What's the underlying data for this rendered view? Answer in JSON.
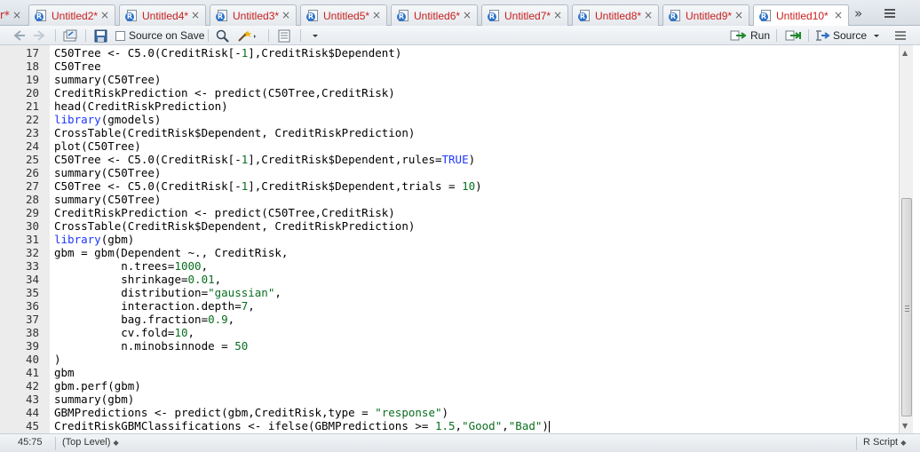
{
  "tabs": {
    "partial_label": "r*",
    "close_symbol": "×",
    "items": [
      {
        "label": "Untitled2*",
        "active": false
      },
      {
        "label": "Untitled4*",
        "active": false
      },
      {
        "label": "Untitled3*",
        "active": false
      },
      {
        "label": "Untitled5*",
        "active": false
      },
      {
        "label": "Untitled6*",
        "active": false
      },
      {
        "label": "Untitled7*",
        "active": false
      },
      {
        "label": "Untitled8*",
        "active": false
      },
      {
        "label": "Untitled9*",
        "active": false
      },
      {
        "label": "Untitled10*",
        "active": true
      }
    ],
    "overflow_symbol": "»"
  },
  "toolbar": {
    "source_on_save_label": "Source on Save",
    "run_label": "Run",
    "source_label": "Source"
  },
  "editor": {
    "lines": [
      {
        "num": "17",
        "code": "C50Tree <- C5.0(CreditRisk[-1],CreditRisk$Dependent)"
      },
      {
        "num": "18",
        "code": "C50Tree"
      },
      {
        "num": "19",
        "code": "summary(C50Tree)"
      },
      {
        "num": "20",
        "code": "CreditRiskPrediction <- predict(C50Tree,CreditRisk)"
      },
      {
        "num": "21",
        "code": "head(CreditRiskPrediction)"
      },
      {
        "num": "22",
        "code": "library(gmodels)"
      },
      {
        "num": "23",
        "code": "CrossTable(CreditRisk$Dependent, CreditRiskPrediction)"
      },
      {
        "num": "24",
        "code": "plot(C50Tree)"
      },
      {
        "num": "25",
        "code": "C50Tree <- C5.0(CreditRisk[-1],CreditRisk$Dependent,rules=TRUE)"
      },
      {
        "num": "26",
        "code": "summary(C50Tree)"
      },
      {
        "num": "27",
        "code": "C50Tree <- C5.0(CreditRisk[-1],CreditRisk$Dependent,trials = 10)"
      },
      {
        "num": "28",
        "code": "summary(C50Tree)"
      },
      {
        "num": "29",
        "code": "CreditRiskPrediction <- predict(C50Tree,CreditRisk)"
      },
      {
        "num": "30",
        "code": "CrossTable(CreditRisk$Dependent, CreditRiskPrediction)"
      },
      {
        "num": "31",
        "code": "library(gbm)"
      },
      {
        "num": "32",
        "code": "gbm = gbm(Dependent ~., CreditRisk,"
      },
      {
        "num": "33",
        "code": "          n.trees=1000,"
      },
      {
        "num": "34",
        "code": "          shrinkage=0.01,"
      },
      {
        "num": "35",
        "code": "          distribution=\"gaussian\","
      },
      {
        "num": "36",
        "code": "          interaction.depth=7,"
      },
      {
        "num": "37",
        "code": "          bag.fraction=0.9,"
      },
      {
        "num": "38",
        "code": "          cv.fold=10,"
      },
      {
        "num": "39",
        "code": "          n.minobsinnode = 50"
      },
      {
        "num": "40",
        "code": ")"
      },
      {
        "num": "41",
        "code": "gbm"
      },
      {
        "num": "42",
        "code": "gbm.perf(gbm)"
      },
      {
        "num": "43",
        "code": "summary(gbm)"
      },
      {
        "num": "44",
        "code": "GBMPredictions <- predict(gbm,CreditRisk,type = \"response\")"
      },
      {
        "num": "45",
        "code": "CreditRiskGBMClassifications <- ifelse(GBMPredictions >= 1.5,\"Good\",\"Bad\")"
      }
    ]
  },
  "status": {
    "cursor_position": "45:75",
    "scope": "(Top Level)",
    "file_type": "R Script"
  }
}
